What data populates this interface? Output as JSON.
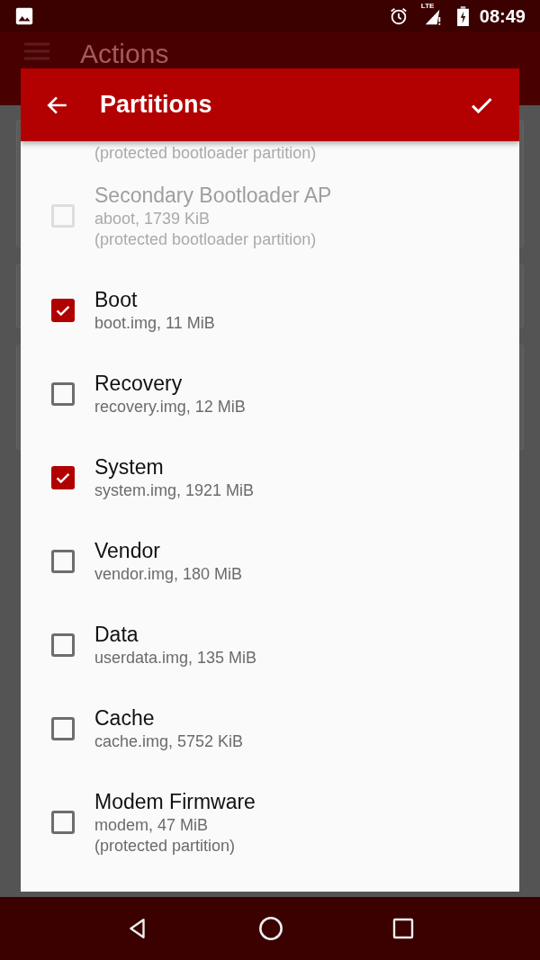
{
  "status_bar": {
    "network": "LTE",
    "time": "08:49"
  },
  "app_bar": {
    "title": "Actions"
  },
  "dialog": {
    "title": "Partitions",
    "items": [
      {
        "note": "(protected bootloader partition)",
        "disabled": true
      },
      {
        "title": "Secondary Bootloader AP",
        "detail": "aboot, 1739 KiB",
        "note": "(protected bootloader partition)",
        "checked": false,
        "disabled": true
      },
      {
        "title": "Boot",
        "detail": "boot.img, 11 MiB",
        "checked": true,
        "disabled": false
      },
      {
        "title": "Recovery",
        "detail": "recovery.img, 12 MiB",
        "checked": false,
        "disabled": false
      },
      {
        "title": "System",
        "detail": "system.img, 1921 MiB",
        "checked": true,
        "disabled": false
      },
      {
        "title": "Vendor",
        "detail": "vendor.img, 180 MiB",
        "checked": false,
        "disabled": false
      },
      {
        "title": "Data",
        "detail": "userdata.img, 135 MiB",
        "checked": false,
        "disabled": false
      },
      {
        "title": "Cache",
        "detail": "cache.img, 5752 KiB",
        "checked": false,
        "disabled": false
      },
      {
        "title": "Modem Firmware",
        "detail": "modem, 47 MiB",
        "note": "(protected partition)",
        "checked": false,
        "disabled": false
      }
    ]
  }
}
